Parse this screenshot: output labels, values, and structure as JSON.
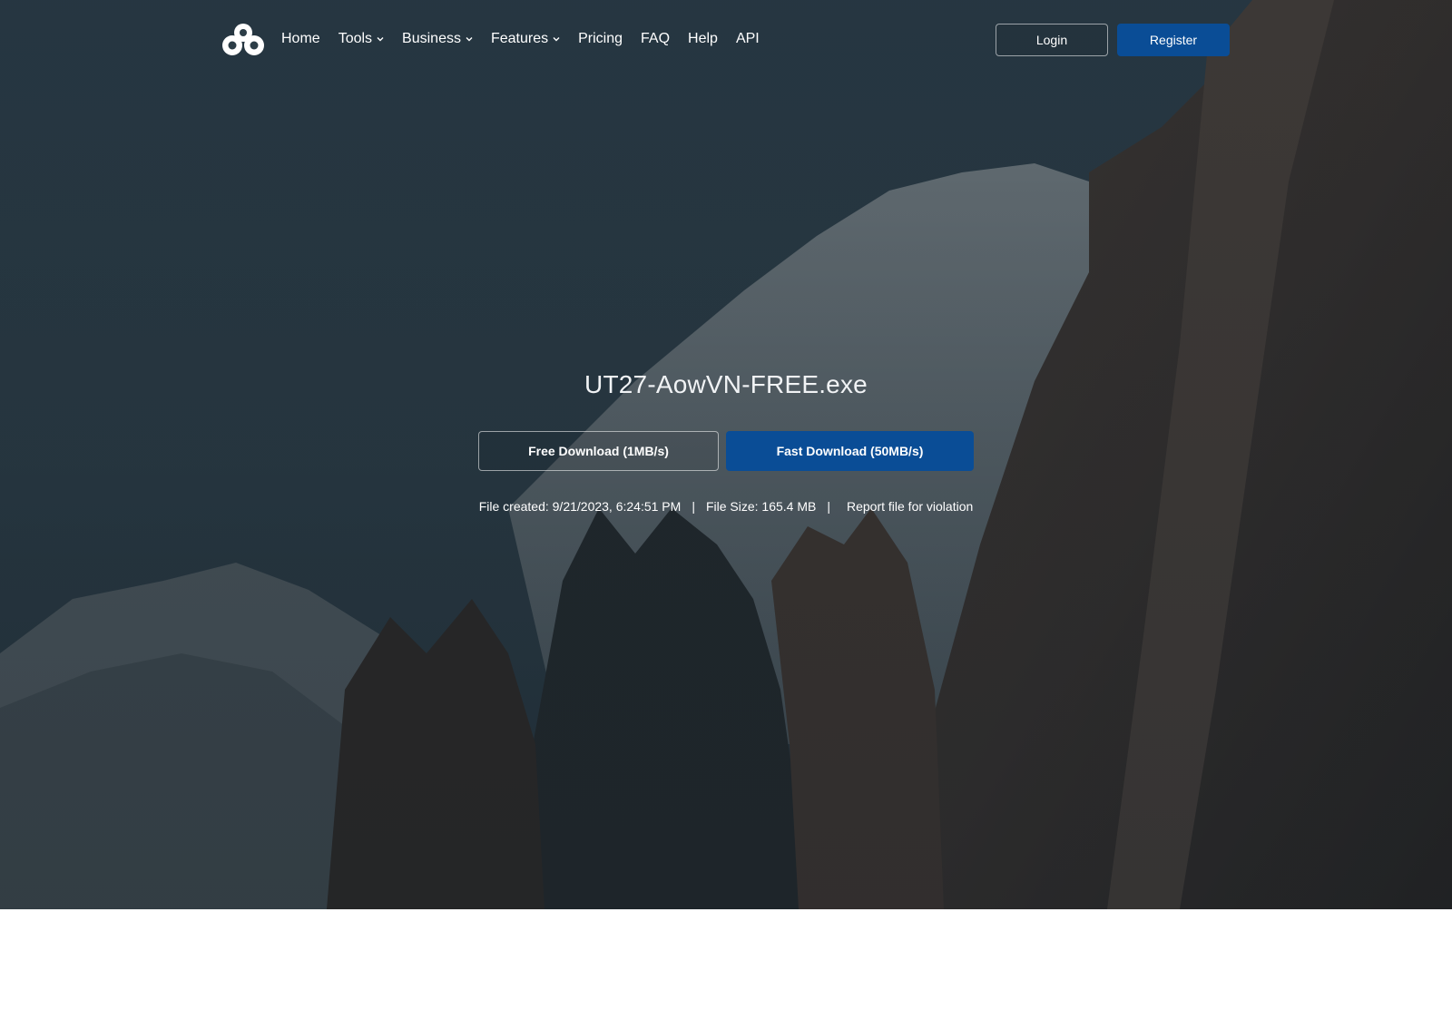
{
  "nav": {
    "logo_icon": "cloud-logo-icon",
    "items": [
      {
        "label": "Home",
        "dropdown": false
      },
      {
        "label": "Tools",
        "dropdown": true
      },
      {
        "label": "Business",
        "dropdown": true
      },
      {
        "label": "Features",
        "dropdown": true
      },
      {
        "label": "Pricing",
        "dropdown": false
      },
      {
        "label": "FAQ",
        "dropdown": false
      },
      {
        "label": "Help",
        "dropdown": false
      },
      {
        "label": "API",
        "dropdown": false
      }
    ],
    "login_label": "Login",
    "register_label": "Register"
  },
  "file": {
    "name": "UT27-AowVN-FREE.exe",
    "free_download_label": "Free Download (1MB/s)",
    "fast_download_label": "Fast Download (50MB/s)",
    "created": "File created: 9/21/2023, 6:24:51 PM",
    "size": "File Size: 165.4 MB",
    "separator": "|",
    "report_label": "Report file for violation"
  },
  "colors": {
    "accent": "#0a4d96",
    "hero_overlay": "#263742"
  }
}
